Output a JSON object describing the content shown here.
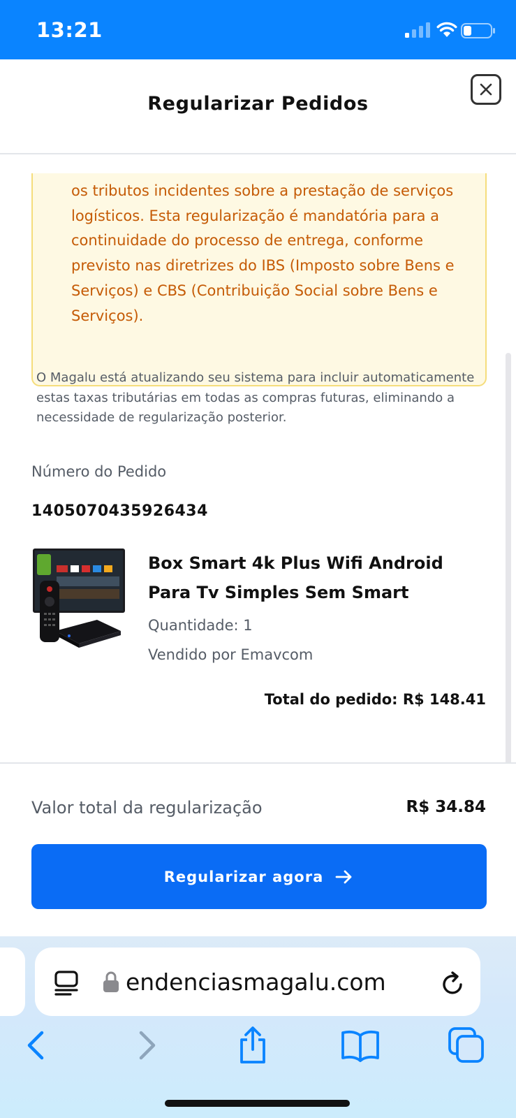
{
  "status_bar": {
    "time": "13:21",
    "signal_icon": "cellular-signal-icon",
    "wifi_icon": "wifi-icon",
    "battery_icon": "battery-icon"
  },
  "modal": {
    "title": "Regularizar Pedidos",
    "close_icon": "close-icon",
    "warning_text": "os tributos incidentes sobre a prestação de serviços logísticos. Esta regularização é mandatória para a continuidade do processo de entrega, conforme previsto nas diretrizes do IBS (Imposto sobre Bens e Serviços) e CBS (Contribuição Social sobre Bens e Serviços).",
    "info_text": "O Magalu está atualizando seu sistema para incluir automaticamente estas taxas tributárias em todas as compras futuras, eliminando a necessidade de regularização posterior.",
    "order_number_label": "Número do Pedido",
    "order_number": "1405070435926434",
    "product": {
      "name": "Box Smart 4k Plus Wifi Android Para Tv Simples Sem Smart",
      "quantity": "Quantidade: 1",
      "seller": "Vendido por Emavcom",
      "image": "tv-box-product-image"
    },
    "order_total": "Total do pedido: R$ 148.41",
    "footer": {
      "total_label": "Valor total da regularização",
      "total_value": "R$ 34.84",
      "button_label": "Regularizar agora",
      "button_icon": "arrow-right-icon"
    }
  },
  "browser": {
    "url": "endenciasmagalu.com",
    "reader_icon": "reader-mode-icon",
    "lock_icon": "lock-icon",
    "reload_icon": "reload-icon",
    "toolbar": [
      "back-icon",
      "forward-icon",
      "share-icon",
      "bookmarks-icon",
      "tabs-icon"
    ],
    "accent": "#0a84ff"
  },
  "colors": {
    "status_bar": "#0a84ff",
    "primary_button": "#0a6cf5",
    "warning_text": "#c55b06",
    "warning_bg": "#fef9e3",
    "warning_border": "#f5dd7c"
  }
}
